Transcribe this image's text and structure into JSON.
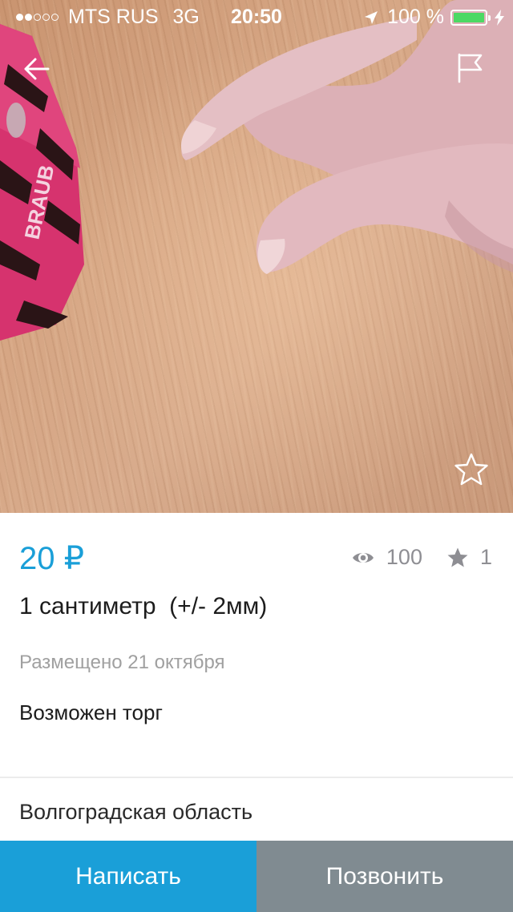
{
  "status_bar": {
    "signal_filled": 2,
    "signal_total": 5,
    "carrier": "MTS RUS",
    "network": "3G",
    "time": "20:50",
    "battery_percent": "100 %",
    "battery_level": 1.0,
    "battery_color": "#4cd964",
    "icons": [
      "location-arrow-icon",
      "battery-icon",
      "charging-bolt-icon"
    ]
  },
  "toolbar": {
    "back_icon": "arrow-left-icon",
    "report_icon": "flag-icon",
    "favorite_icon": "star-outline-icon"
  },
  "listing": {
    "price": "20 ₽",
    "views": "100",
    "favorites": "1",
    "title": "1 сантиметр  (+/- 2мм)",
    "posted": "Размещено 21 октября",
    "note": "Возможен торг",
    "region": "Волгоградская область",
    "photo_text": "BRAUB"
  },
  "actions": {
    "write_label": "Написать",
    "call_label": "Позвонить"
  },
  "colors": {
    "accent": "#1a9fd8",
    "call_button": "#808b91",
    "muted_text": "#a0a0a0"
  }
}
